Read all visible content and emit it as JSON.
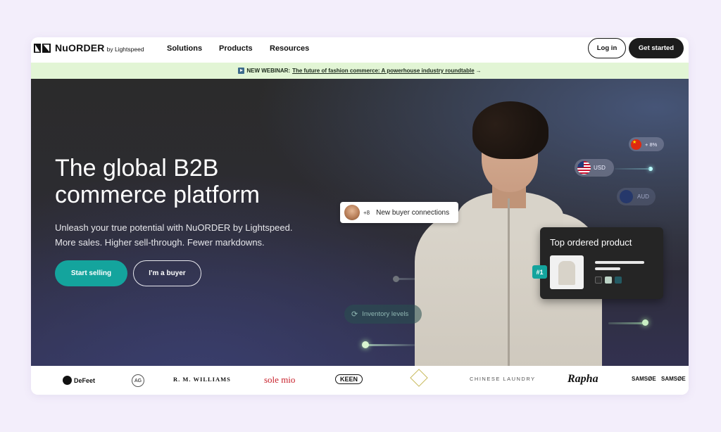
{
  "brand": {
    "name": "NuORDER",
    "by": "by Lightspeed"
  },
  "nav": {
    "solutions": "Solutions",
    "products": "Products",
    "resources": "Resources"
  },
  "header": {
    "login": "Log in",
    "get_started": "Get started"
  },
  "banner": {
    "prefix": "NEW WEBINAR:",
    "link": "The future of fashion commerce: A powerhouse industry roundtable",
    "arrow": "→"
  },
  "hero": {
    "title": "The global B2B commerce platform",
    "subtitle_line1": "Unleash your true potential with NuORDER by Lightspeed.",
    "subtitle_line2": "More sales. Higher sell-through. Fewer markdowns.",
    "cta_primary": "Start selling",
    "cta_secondary": "I'm a buyer"
  },
  "floating": {
    "buyer_count": "+8",
    "buyer_label": "New buyer connections",
    "top_title": "Top ordered product",
    "rank": "#1",
    "usd": "USD",
    "aud": "AUD",
    "cn": "+ 8%",
    "inventory": "Inventory levels"
  },
  "colors": {
    "accent": "#14a49d",
    "banner": "#e2f5d5",
    "dark": "#1c1c1c"
  },
  "logos": [
    "DeFeet",
    "AG",
    "R. M. WILLIAMS",
    "sole mio",
    "KEEN",
    "CHINESE LAUNDRY",
    "Rapha",
    "SAMSØE",
    "SAMSØE"
  ]
}
